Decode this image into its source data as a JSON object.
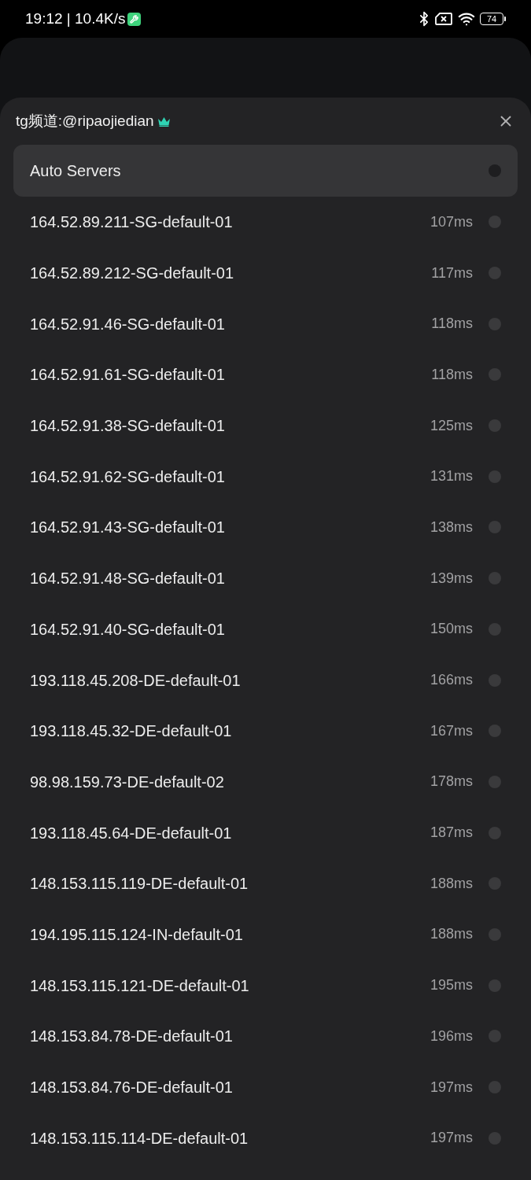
{
  "status_bar": {
    "network_info": "19:12 | 10.4K/s",
    "battery": "74"
  },
  "sheet": {
    "title": "tg频道:@ripaojiedian"
  },
  "proxies": [
    {
      "name": "Auto Servers",
      "selected": true
    },
    {
      "name": "164.52.89.211-SG-default-01",
      "latency": "107ms",
      "selected": false
    },
    {
      "name": "164.52.89.212-SG-default-01",
      "latency": "117ms",
      "selected": false
    },
    {
      "name": "164.52.91.46-SG-default-01",
      "latency": "118ms",
      "selected": false
    },
    {
      "name": "164.52.91.61-SG-default-01",
      "latency": "118ms",
      "selected": false
    },
    {
      "name": "164.52.91.38-SG-default-01",
      "latency": "125ms",
      "selected": false
    },
    {
      "name": "164.52.91.62-SG-default-01",
      "latency": "131ms",
      "selected": false
    },
    {
      "name": "164.52.91.43-SG-default-01",
      "latency": "138ms",
      "selected": false
    },
    {
      "name": "164.52.91.48-SG-default-01",
      "latency": "139ms",
      "selected": false
    },
    {
      "name": "164.52.91.40-SG-default-01",
      "latency": "150ms",
      "selected": false
    },
    {
      "name": "193.118.45.208-DE-default-01",
      "latency": "166ms",
      "selected": false
    },
    {
      "name": "193.118.45.32-DE-default-01",
      "latency": "167ms",
      "selected": false
    },
    {
      "name": "98.98.159.73-DE-default-02",
      "latency": "178ms",
      "selected": false
    },
    {
      "name": "193.118.45.64-DE-default-01",
      "latency": "187ms",
      "selected": false
    },
    {
      "name": "148.153.115.119-DE-default-01",
      "latency": "188ms",
      "selected": false
    },
    {
      "name": "194.195.115.124-IN-default-01",
      "latency": "188ms",
      "selected": false
    },
    {
      "name": "148.153.115.121-DE-default-01",
      "latency": "195ms",
      "selected": false
    },
    {
      "name": "148.153.84.78-DE-default-01",
      "latency": "196ms",
      "selected": false
    },
    {
      "name": "148.153.84.76-DE-default-01",
      "latency": "197ms",
      "selected": false
    },
    {
      "name": "148.153.115.114-DE-default-01",
      "latency": "197ms",
      "selected": false
    }
  ]
}
